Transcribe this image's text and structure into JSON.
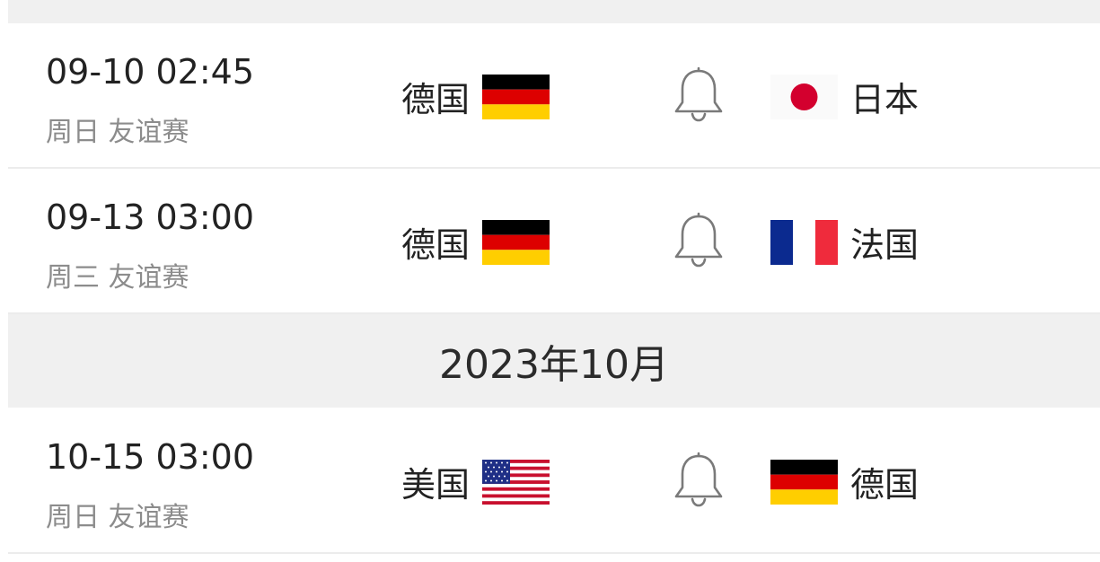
{
  "matches": [
    {
      "time": "09-10 02:45",
      "day": "周日",
      "competition": "友谊赛",
      "home": {
        "name": "德国",
        "flag": "germany-flag"
      },
      "away": {
        "name": "日本",
        "flag": "japan-flag"
      }
    },
    {
      "time": "09-13 03:00",
      "day": "周三",
      "competition": "友谊赛",
      "home": {
        "name": "德国",
        "flag": "germany-flag"
      },
      "away": {
        "name": "法国",
        "flag": "france-flag"
      }
    },
    {
      "time": "10-15 03:00",
      "day": "周日",
      "competition": "友谊赛",
      "home": {
        "name": "美国",
        "flag": "usa-flag"
      },
      "away": {
        "name": "德国",
        "flag": "germany-flag"
      }
    }
  ],
  "month_header": {
    "label": "2023年10月"
  },
  "colors": {
    "separator_bg": "#f0f0f0",
    "text_primary": "#222222",
    "text_secondary": "#8c8c8c",
    "bell_stroke": "#7a7a7a"
  },
  "icons": {
    "reminder": "bell-icon"
  }
}
